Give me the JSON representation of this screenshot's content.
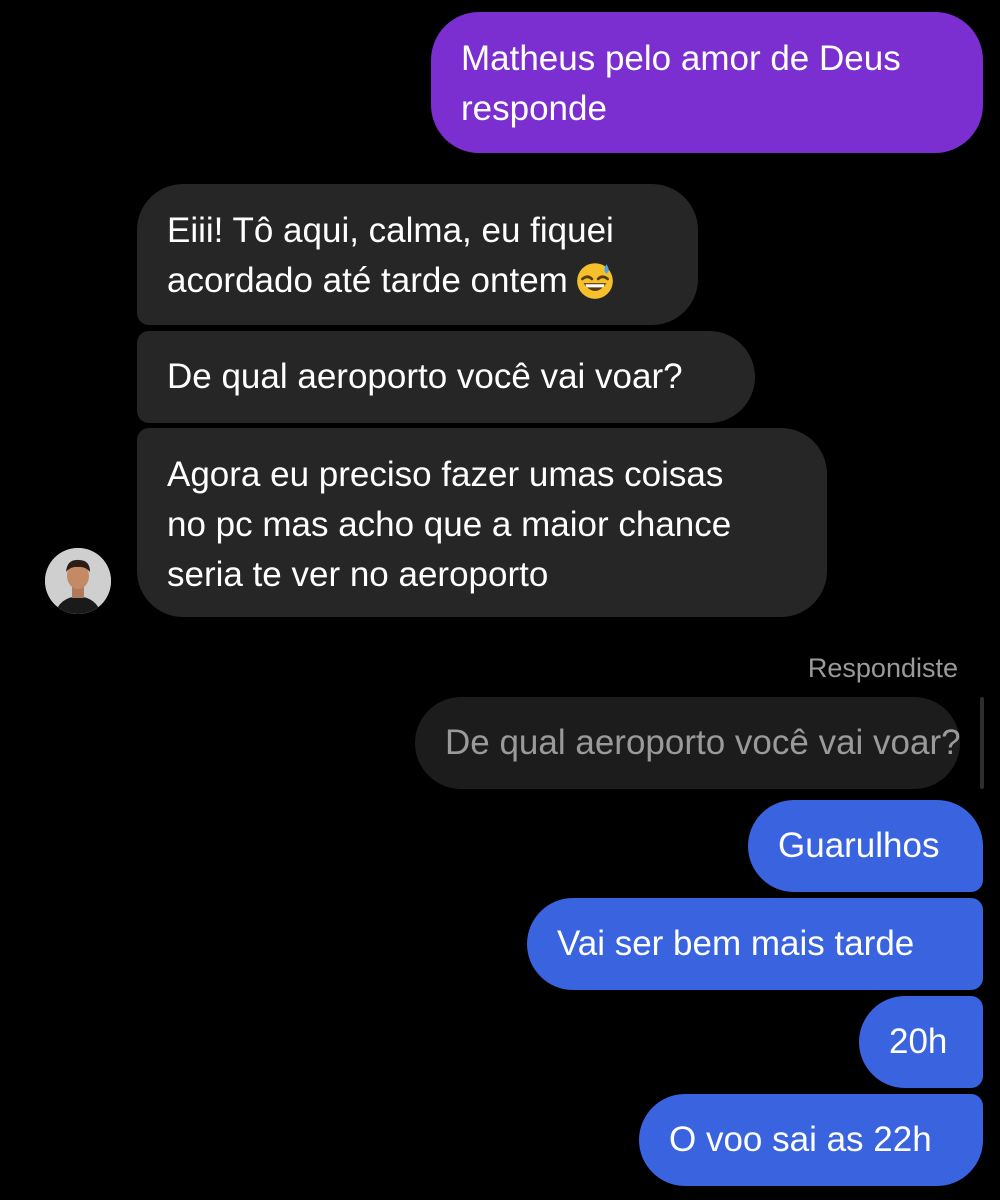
{
  "messages": {
    "m1": {
      "lines": [
        "Matheus pelo amor de Deus",
        "responde"
      ]
    },
    "m2": {
      "lines": [
        "Eiii! Tô aqui, calma, eu fiquei",
        "acordado até tarde ontem"
      ],
      "emoji": "grinning-face-with-sweat"
    },
    "m3": {
      "text": "De qual aeroporto você vai voar?"
    },
    "m4": {
      "lines": [
        "Agora eu preciso fazer umas coisas",
        "no pc mas acho que a maior chance",
        "seria te ver no aeroporto"
      ]
    },
    "reply": {
      "label": "Respondiste",
      "quoted_text": "De qual aeroporto você vai voar?"
    },
    "m5": {
      "text": "Guarulhos"
    },
    "m6": {
      "text": "Vai ser bem mais tarde"
    },
    "m7": {
      "text": "20h"
    },
    "m8": {
      "text": "O voo sai as 22h"
    }
  },
  "colors": {
    "background": "#000000",
    "outgoing_purple": "#7b2fd0",
    "outgoing_blue": "#3a63e0",
    "incoming_gray": "#262626",
    "reply_quote": "#1c1c1c",
    "muted_text": "#9a9a9a"
  },
  "avatar": {
    "icon": "contact-avatar"
  }
}
